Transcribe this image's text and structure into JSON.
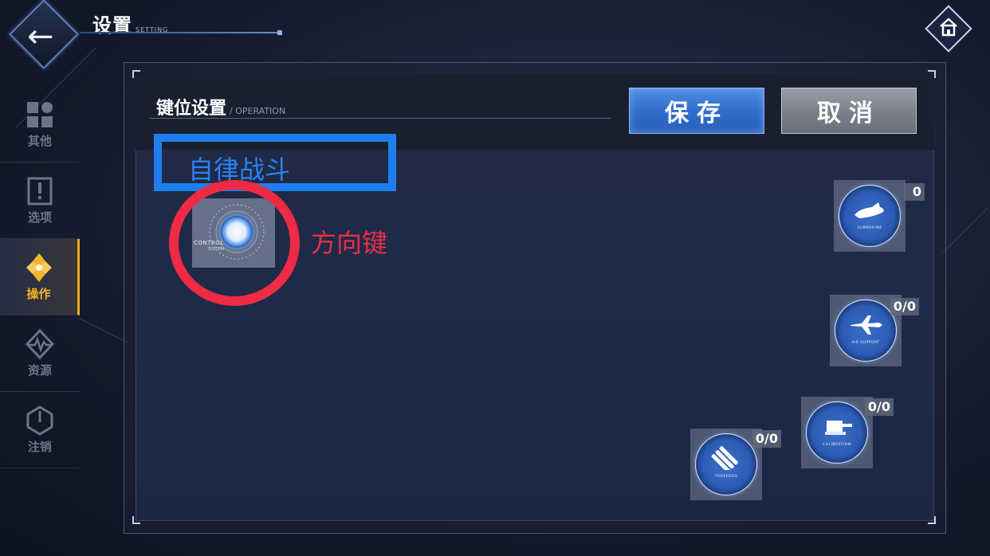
{
  "header": {
    "title": "设置",
    "subtitle": "SETTING"
  },
  "sidebar": {
    "items": [
      {
        "label": "其他",
        "icon": "grid-icon",
        "active": false
      },
      {
        "label": "选项",
        "icon": "option-icon",
        "active": false
      },
      {
        "label": "操作",
        "icon": "operation-icon",
        "active": true
      },
      {
        "label": "资源",
        "icon": "resource-icon",
        "active": false
      },
      {
        "label": "注销",
        "icon": "power-icon",
        "active": false
      }
    ]
  },
  "panel": {
    "title": "键位设置",
    "subtitle": "/ OPERATION",
    "save_label": "保存",
    "cancel_label": "取消"
  },
  "annotations": {
    "box_label": "自律战斗",
    "circle_label": "方向键",
    "box_color": "#1e7ef0",
    "circle_color": "#ee2b44"
  },
  "control": {
    "line1": "CONTROL",
    "line2": "SYSTEM"
  },
  "skills": [
    {
      "name": "SUBMARINE",
      "count": "0",
      "icon": "submarine-icon"
    },
    {
      "name": "AIR SUPPORT",
      "count": "0/0",
      "icon": "plane-icon"
    },
    {
      "name": "CALIBRATION",
      "count": "0/0",
      "icon": "turret-icon"
    },
    {
      "name": "TORPEDOS",
      "count": "0/0",
      "icon": "torpedo-icon"
    }
  ],
  "colors": {
    "accent": "#f0a822",
    "save": "#2f6ccc",
    "cancel": "#7a7f8a"
  }
}
